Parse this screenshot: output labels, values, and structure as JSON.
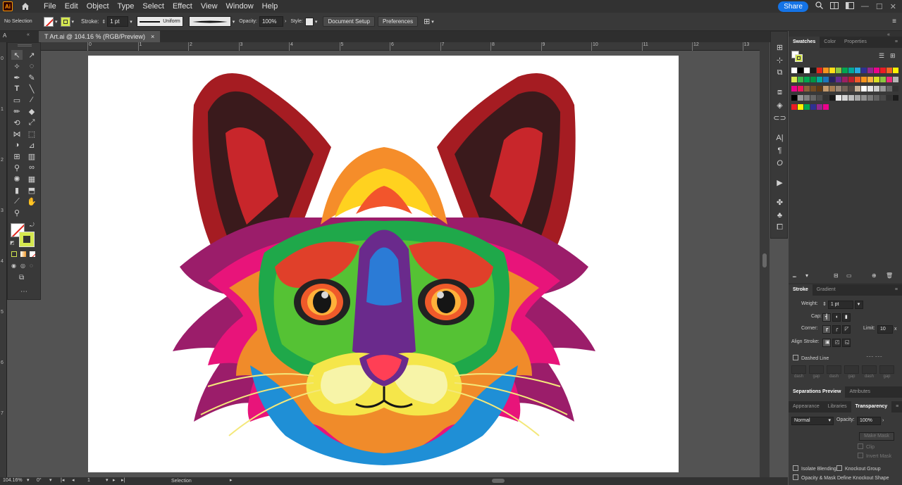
{
  "menubar": {
    "app_logo": "Ai",
    "items": [
      "File",
      "Edit",
      "Object",
      "Type",
      "Select",
      "Effect",
      "View",
      "Window",
      "Help"
    ],
    "share_label": "Share"
  },
  "control": {
    "selection_label": "No Selection",
    "stroke_label": "Stroke:",
    "stroke_weight": "1 pt",
    "stroke_profile": "Uniform",
    "opacity_label": "Opacity:",
    "opacity_value": "100%",
    "style_label": "Style:",
    "document_setup": "Document Setup",
    "preferences": "Preferences"
  },
  "document": {
    "tab_title": "T Art.ai @ 104.16 % (RGB/Preview)",
    "close_glyph": "×",
    "panel_glyph": "A"
  },
  "ruler": {
    "h_labels": [
      "0",
      "1",
      "2",
      "3",
      "4",
      "5",
      "6",
      "7",
      "8",
      "9",
      "10",
      "11",
      "12",
      "13"
    ],
    "v_labels": [
      "0",
      "1",
      "2",
      "3",
      "4",
      "5",
      "6",
      "7"
    ]
  },
  "status": {
    "zoom": "104.16%",
    "rotation": "0°",
    "artboard_num": "1",
    "tool_name": "Selection"
  },
  "panels": {
    "swatches_tabs": [
      "Swatches",
      "Color",
      "Properties"
    ],
    "stroke_tabs": [
      "Stroke",
      "Gradient"
    ],
    "weight_label": "Weight:",
    "weight_value": "1 pt",
    "cap_label": "Cap:",
    "corner_label": "Corner:",
    "limit_label": "Limit:",
    "limit_value": "10",
    "align_label": "Align Stroke:",
    "dashed_label": "Dashed Line",
    "dash_labels": [
      "dash",
      "gap",
      "dash",
      "gap",
      "dash",
      "gap"
    ],
    "sep_tabs": [
      "Separations Preview",
      "Attributes"
    ],
    "transp_tabs": [
      "Appearance",
      "Libraries",
      "Transparency"
    ],
    "blend_mode": "Normal",
    "opacity_label": "Opacity:",
    "opacity_value": "100%",
    "make_mask": "Make Mask",
    "clip": "Clip",
    "invert_mask": "Invert Mask",
    "isolate": "Isolate Blending",
    "knockout": "Knockout Group",
    "opacity_mask": "Opacity & Mask Define Knockout Shape"
  },
  "colors": {
    "fill_accent": "#d5e84f",
    "artboard": "#ffffff"
  }
}
